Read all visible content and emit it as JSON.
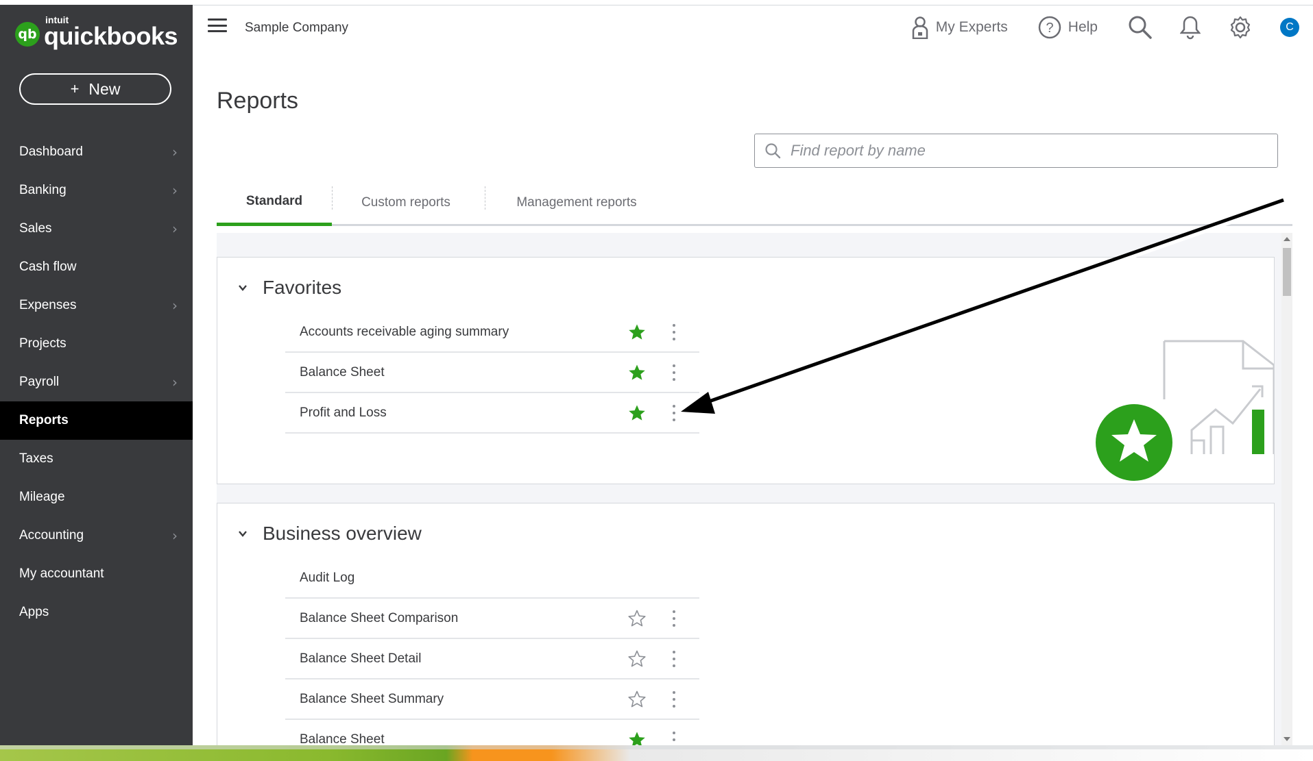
{
  "app": {
    "brand_small": "intuit",
    "brand_name": "quickbooks",
    "logo_badge": "qb",
    "company": "Sample Company"
  },
  "sidebar": {
    "new_label": "New",
    "items": [
      {
        "label": "Dashboard",
        "chevron": true
      },
      {
        "label": "Banking",
        "chevron": true
      },
      {
        "label": "Sales",
        "chevron": true
      },
      {
        "label": "Cash flow",
        "chevron": false
      },
      {
        "label": "Expenses",
        "chevron": true
      },
      {
        "label": "Projects",
        "chevron": false
      },
      {
        "label": "Payroll",
        "chevron": true
      },
      {
        "label": "Reports",
        "chevron": false,
        "active": true
      },
      {
        "label": "Taxes",
        "chevron": false
      },
      {
        "label": "Mileage",
        "chevron": false
      },
      {
        "label": "Accounting",
        "chevron": true
      },
      {
        "label": "My accountant",
        "chevron": false
      },
      {
        "label": "Apps",
        "chevron": false
      }
    ]
  },
  "header": {
    "my_experts": "My Experts",
    "help": "Help",
    "avatar_initial": "C"
  },
  "main": {
    "title": "Reports",
    "search_placeholder": "Find report by name",
    "tabs": [
      {
        "label": "Standard",
        "active": true
      },
      {
        "label": "Custom reports",
        "active": false
      },
      {
        "label": "Management reports",
        "active": false
      }
    ],
    "sections": [
      {
        "title": "Favorites",
        "rows": [
          {
            "name": "Accounts receivable aging summary",
            "favorite": true
          },
          {
            "name": "Balance Sheet",
            "favorite": true
          },
          {
            "name": "Profit and Loss",
            "favorite": true
          }
        ]
      },
      {
        "title": "Business overview",
        "rows": [
          {
            "name": "Audit Log",
            "favorite": null
          },
          {
            "name": "Balance Sheet Comparison",
            "favorite": false
          },
          {
            "name": "Balance Sheet Detail",
            "favorite": false
          },
          {
            "name": "Balance Sheet Summary",
            "favorite": false
          },
          {
            "name": "Balance Sheet",
            "favorite": true
          }
        ]
      }
    ]
  },
  "colors": {
    "brand_green": "#2ca01c",
    "sidebar_bg": "#393a3d",
    "active_nav_bg": "#000000",
    "avatar_blue": "#0077c5",
    "star_outline": "#8d9096"
  },
  "icons": {
    "my_experts": "person-icon",
    "help": "help-circle-icon",
    "search": "search-icon",
    "notifications": "bell-icon",
    "settings": "gear-icon",
    "favorite": "star-icon",
    "more": "kebab-menu-icon",
    "collapse": "chevron-down-icon"
  }
}
